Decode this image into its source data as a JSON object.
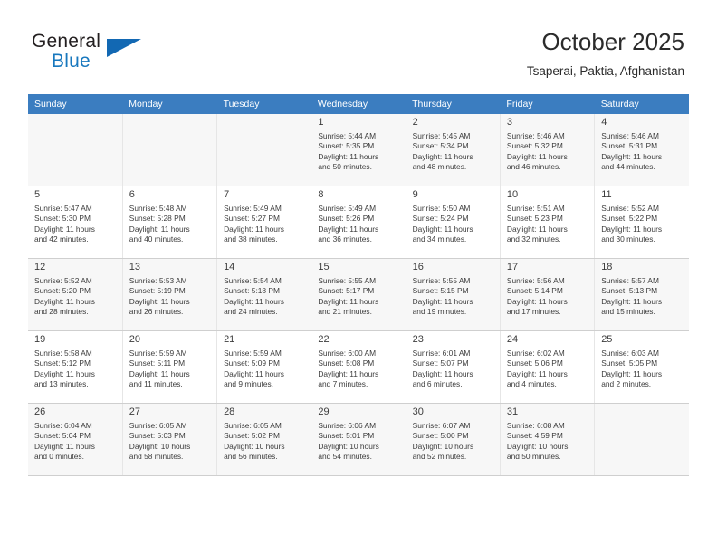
{
  "brand": {
    "line1": "General",
    "line2": "Blue",
    "logo_icon": "triangle-flag-icon",
    "accent_color": "#1268b3"
  },
  "header": {
    "title": "October 2025",
    "subtitle": "Tsaperai, Paktia, Afghanistan"
  },
  "theme": {
    "header_row_bg": "#3b7dc0",
    "shaded_row_bg": "#f7f7f7",
    "text_color": "#3c3c3c"
  },
  "calendar": {
    "weekday_headers": [
      "Sunday",
      "Monday",
      "Tuesday",
      "Wednesday",
      "Thursday",
      "Friday",
      "Saturday"
    ],
    "weeks": [
      [
        {
          "day": "",
          "lines": []
        },
        {
          "day": "",
          "lines": []
        },
        {
          "day": "",
          "lines": []
        },
        {
          "day": "1",
          "lines": [
            "Sunrise: 5:44 AM",
            "Sunset: 5:35 PM",
            "Daylight: 11 hours",
            "and 50 minutes."
          ]
        },
        {
          "day": "2",
          "lines": [
            "Sunrise: 5:45 AM",
            "Sunset: 5:34 PM",
            "Daylight: 11 hours",
            "and 48 minutes."
          ]
        },
        {
          "day": "3",
          "lines": [
            "Sunrise: 5:46 AM",
            "Sunset: 5:32 PM",
            "Daylight: 11 hours",
            "and 46 minutes."
          ]
        },
        {
          "day": "4",
          "lines": [
            "Sunrise: 5:46 AM",
            "Sunset: 5:31 PM",
            "Daylight: 11 hours",
            "and 44 minutes."
          ]
        }
      ],
      [
        {
          "day": "5",
          "lines": [
            "Sunrise: 5:47 AM",
            "Sunset: 5:30 PM",
            "Daylight: 11 hours",
            "and 42 minutes."
          ]
        },
        {
          "day": "6",
          "lines": [
            "Sunrise: 5:48 AM",
            "Sunset: 5:28 PM",
            "Daylight: 11 hours",
            "and 40 minutes."
          ]
        },
        {
          "day": "7",
          "lines": [
            "Sunrise: 5:49 AM",
            "Sunset: 5:27 PM",
            "Daylight: 11 hours",
            "and 38 minutes."
          ]
        },
        {
          "day": "8",
          "lines": [
            "Sunrise: 5:49 AM",
            "Sunset: 5:26 PM",
            "Daylight: 11 hours",
            "and 36 minutes."
          ]
        },
        {
          "day": "9",
          "lines": [
            "Sunrise: 5:50 AM",
            "Sunset: 5:24 PM",
            "Daylight: 11 hours",
            "and 34 minutes."
          ]
        },
        {
          "day": "10",
          "lines": [
            "Sunrise: 5:51 AM",
            "Sunset: 5:23 PM",
            "Daylight: 11 hours",
            "and 32 minutes."
          ]
        },
        {
          "day": "11",
          "lines": [
            "Sunrise: 5:52 AM",
            "Sunset: 5:22 PM",
            "Daylight: 11 hours",
            "and 30 minutes."
          ]
        }
      ],
      [
        {
          "day": "12",
          "lines": [
            "Sunrise: 5:52 AM",
            "Sunset: 5:20 PM",
            "Daylight: 11 hours",
            "and 28 minutes."
          ]
        },
        {
          "day": "13",
          "lines": [
            "Sunrise: 5:53 AM",
            "Sunset: 5:19 PM",
            "Daylight: 11 hours",
            "and 26 minutes."
          ]
        },
        {
          "day": "14",
          "lines": [
            "Sunrise: 5:54 AM",
            "Sunset: 5:18 PM",
            "Daylight: 11 hours",
            "and 24 minutes."
          ]
        },
        {
          "day": "15",
          "lines": [
            "Sunrise: 5:55 AM",
            "Sunset: 5:17 PM",
            "Daylight: 11 hours",
            "and 21 minutes."
          ]
        },
        {
          "day": "16",
          "lines": [
            "Sunrise: 5:55 AM",
            "Sunset: 5:15 PM",
            "Daylight: 11 hours",
            "and 19 minutes."
          ]
        },
        {
          "day": "17",
          "lines": [
            "Sunrise: 5:56 AM",
            "Sunset: 5:14 PM",
            "Daylight: 11 hours",
            "and 17 minutes."
          ]
        },
        {
          "day": "18",
          "lines": [
            "Sunrise: 5:57 AM",
            "Sunset: 5:13 PM",
            "Daylight: 11 hours",
            "and 15 minutes."
          ]
        }
      ],
      [
        {
          "day": "19",
          "lines": [
            "Sunrise: 5:58 AM",
            "Sunset: 5:12 PM",
            "Daylight: 11 hours",
            "and 13 minutes."
          ]
        },
        {
          "day": "20",
          "lines": [
            "Sunrise: 5:59 AM",
            "Sunset: 5:11 PM",
            "Daylight: 11 hours",
            "and 11 minutes."
          ]
        },
        {
          "day": "21",
          "lines": [
            "Sunrise: 5:59 AM",
            "Sunset: 5:09 PM",
            "Daylight: 11 hours",
            "and 9 minutes."
          ]
        },
        {
          "day": "22",
          "lines": [
            "Sunrise: 6:00 AM",
            "Sunset: 5:08 PM",
            "Daylight: 11 hours",
            "and 7 minutes."
          ]
        },
        {
          "day": "23",
          "lines": [
            "Sunrise: 6:01 AM",
            "Sunset: 5:07 PM",
            "Daylight: 11 hours",
            "and 6 minutes."
          ]
        },
        {
          "day": "24",
          "lines": [
            "Sunrise: 6:02 AM",
            "Sunset: 5:06 PM",
            "Daylight: 11 hours",
            "and 4 minutes."
          ]
        },
        {
          "day": "25",
          "lines": [
            "Sunrise: 6:03 AM",
            "Sunset: 5:05 PM",
            "Daylight: 11 hours",
            "and 2 minutes."
          ]
        }
      ],
      [
        {
          "day": "26",
          "lines": [
            "Sunrise: 6:04 AM",
            "Sunset: 5:04 PM",
            "Daylight: 11 hours",
            "and 0 minutes."
          ]
        },
        {
          "day": "27",
          "lines": [
            "Sunrise: 6:05 AM",
            "Sunset: 5:03 PM",
            "Daylight: 10 hours",
            "and 58 minutes."
          ]
        },
        {
          "day": "28",
          "lines": [
            "Sunrise: 6:05 AM",
            "Sunset: 5:02 PM",
            "Daylight: 10 hours",
            "and 56 minutes."
          ]
        },
        {
          "day": "29",
          "lines": [
            "Sunrise: 6:06 AM",
            "Sunset: 5:01 PM",
            "Daylight: 10 hours",
            "and 54 minutes."
          ]
        },
        {
          "day": "30",
          "lines": [
            "Sunrise: 6:07 AM",
            "Sunset: 5:00 PM",
            "Daylight: 10 hours",
            "and 52 minutes."
          ]
        },
        {
          "day": "31",
          "lines": [
            "Sunrise: 6:08 AM",
            "Sunset: 4:59 PM",
            "Daylight: 10 hours",
            "and 50 minutes."
          ]
        },
        {
          "day": "",
          "lines": []
        }
      ]
    ]
  }
}
